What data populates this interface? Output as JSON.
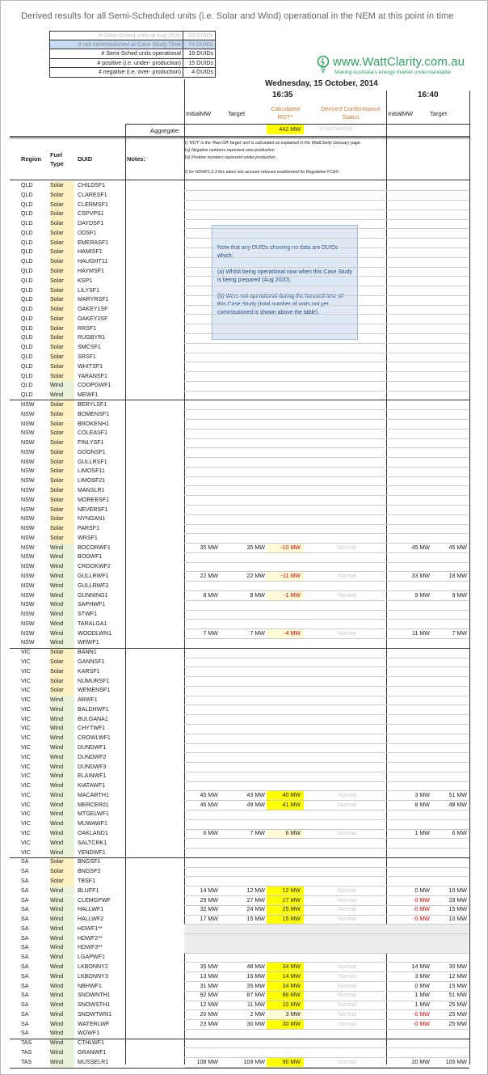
{
  "title": "Derived results for all Semi-Scheduled units (i.e. Solar and Wind) operational in the NEM at this point in time",
  "summary": [
    {
      "label": "# Semi-Sched units at Aug 2020",
      "value": "93 DUIDs",
      "style": "dim"
    },
    {
      "label": "# not commissioned at Case Study Time",
      "value": "74 DUIDs",
      "style": "hl"
    },
    {
      "label": "# Semi-Sched units operational",
      "value": "19 DUIDs",
      "style": ""
    },
    {
      "label": "# positive (i.e. under- production)",
      "value": "15 DUIDs",
      "style": ""
    },
    {
      "label": "# negative (i.e. over- production)",
      "value": "4 DUIDs",
      "style": ""
    }
  ],
  "logo": {
    "text": "www.WattClarity.com.au",
    "tagline": "Making Australia's energy market understandable"
  },
  "date": "Wednesday, 15 October, 2014",
  "time1": "16:35",
  "time2": "16:40",
  "headers": {
    "initial": "InitialMW",
    "target": "Target",
    "rot": "Calculated ROT*",
    "status": "Derived Conformance Status",
    "initial2": "InitialMW",
    "target2": "Target",
    "region": "Region",
    "fuel": "Fuel Type",
    "duid": "DUID",
    "notes": "Notes:"
  },
  "aggregate": {
    "label": "Aggregate:",
    "rot": "442 MW",
    "status": "0 not Normal"
  },
  "notes": [
    "1) 'ROT' is the 'Raw Off-Target' and is calculated as explained in the WattClarity Glossary page.",
    "1a) Negative numbers represent over-production",
    "1b) Positive numbers represent under-production .",
    "2) for HDWF1,2,3 this takes into account relevant enablement for Regulation FCAS"
  ],
  "callout": [
    "Note that any DUIDs showing no data are DUIDs which:",
    "(a) Whilst being operational now when this Case Study is being prepared (Aug 2020);",
    "(b) Were not operational during the focused time of this Case Study (total number of units not yet commissioned is shown above the table)."
  ],
  "rows": [
    [
      "QLD",
      "Solar",
      "CHILDSF1",
      "",
      "",
      "",
      "",
      "",
      ""
    ],
    [
      "QLD",
      "Solar",
      "CLARESF1",
      "",
      "",
      "",
      "",
      "",
      ""
    ],
    [
      "QLD",
      "Solar",
      "CLERMSF1",
      "",
      "",
      "",
      "",
      "",
      ""
    ],
    [
      "QLD",
      "Solar",
      "CSPVPS1",
      "",
      "",
      "",
      "",
      "",
      ""
    ],
    [
      "QLD",
      "Solar",
      "DAYDSF1",
      "",
      "",
      "",
      "",
      "",
      ""
    ],
    [
      "QLD",
      "Solar",
      "DDSF1",
      "",
      "",
      "",
      "",
      "",
      ""
    ],
    [
      "QLD",
      "Solar",
      "EMERASF1",
      "",
      "",
      "",
      "",
      "",
      ""
    ],
    [
      "QLD",
      "Solar",
      "HAMISF1",
      "",
      "",
      "",
      "",
      "",
      ""
    ],
    [
      "QLD",
      "Solar",
      "HAUGHT11",
      "",
      "",
      "",
      "",
      "",
      ""
    ],
    [
      "QLD",
      "Solar",
      "HAYMSF1",
      "",
      "",
      "",
      "",
      "",
      ""
    ],
    [
      "QLD",
      "Solar",
      "KSP1",
      "",
      "",
      "",
      "",
      "",
      ""
    ],
    [
      "QLD",
      "Solar",
      "LILYSF1",
      "",
      "",
      "",
      "",
      "",
      ""
    ],
    [
      "QLD",
      "Solar",
      "MARYRSF1",
      "",
      "",
      "",
      "",
      "",
      ""
    ],
    [
      "QLD",
      "Solar",
      "OAKEY1SF",
      "",
      "",
      "",
      "",
      "",
      ""
    ],
    [
      "QLD",
      "Solar",
      "OAKEY2SF",
      "",
      "",
      "",
      "",
      "",
      ""
    ],
    [
      "QLD",
      "Solar",
      "RRSF1",
      "",
      "",
      "",
      "",
      "",
      ""
    ],
    [
      "QLD",
      "Solar",
      "RUGBYR1",
      "",
      "",
      "",
      "",
      "",
      ""
    ],
    [
      "QLD",
      "Solar",
      "SMCSF1",
      "",
      "",
      "",
      "",
      "",
      ""
    ],
    [
      "QLD",
      "Solar",
      "SRSF1",
      "",
      "",
      "",
      "",
      "",
      ""
    ],
    [
      "QLD",
      "Solar",
      "WHITSF1",
      "",
      "",
      "",
      "",
      "",
      ""
    ],
    [
      "QLD",
      "Solar",
      "YARANSF1",
      "",
      "",
      "",
      "",
      "",
      ""
    ],
    [
      "QLD",
      "Wind",
      "COOPGWF1",
      "",
      "",
      "",
      "",
      "",
      ""
    ],
    [
      "QLD",
      "Wind",
      "MEWF1",
      "",
      "",
      "",
      "",
      "",
      ""
    ],
    [
      "NSW",
      "Solar",
      "BERYLSF1",
      "",
      "",
      "",
      "",
      "",
      ""
    ],
    [
      "NSW",
      "Solar",
      "BOMENSF1",
      "",
      "",
      "",
      "",
      "",
      ""
    ],
    [
      "NSW",
      "Solar",
      "BROKENH1",
      "",
      "",
      "",
      "",
      "",
      ""
    ],
    [
      "NSW",
      "Solar",
      "COLEASF1",
      "",
      "",
      "",
      "",
      "",
      ""
    ],
    [
      "NSW",
      "Solar",
      "FINLYSF1",
      "",
      "",
      "",
      "",
      "",
      ""
    ],
    [
      "NSW",
      "Solar",
      "GOONSF1",
      "",
      "",
      "",
      "",
      "",
      ""
    ],
    [
      "NSW",
      "Solar",
      "GULLRSF1",
      "",
      "",
      "",
      "",
      "",
      ""
    ],
    [
      "NSW",
      "Solar",
      "LIMOSF11",
      "",
      "",
      "",
      "",
      "",
      ""
    ],
    [
      "NSW",
      "Solar",
      "LIMOSF21",
      "",
      "",
      "",
      "",
      "",
      ""
    ],
    [
      "NSW",
      "Solar",
      "MANSLR1",
      "",
      "",
      "",
      "",
      "",
      ""
    ],
    [
      "NSW",
      "Solar",
      "MOREESF1",
      "",
      "",
      "",
      "",
      "",
      ""
    ],
    [
      "NSW",
      "Solar",
      "NEVERSF1",
      "",
      "",
      "",
      "",
      "",
      ""
    ],
    [
      "NSW",
      "Solar",
      "NYNGAN1",
      "",
      "",
      "",
      "",
      "",
      ""
    ],
    [
      "NSW",
      "Solar",
      "PARSF1",
      "",
      "",
      "",
      "",
      "",
      ""
    ],
    [
      "NSW",
      "Solar",
      "WRSF1",
      "",
      "",
      "",
      "",
      "",
      ""
    ],
    [
      "NSW",
      "Wind",
      "BOCORWF1",
      "35 MW",
      "35 MW",
      "-10 MW",
      "Normal",
      "45 MW",
      "45 MW"
    ],
    [
      "NSW",
      "Wind",
      "BODWF1",
      "",
      "",
      "",
      "",
      "",
      ""
    ],
    [
      "NSW",
      "Wind",
      "CROOKWF2",
      "",
      "",
      "",
      "",
      "",
      ""
    ],
    [
      "NSW",
      "Wind",
      "GULLRWF1",
      "22 MW",
      "22 MW",
      "-11 MW",
      "Normal",
      "33 MW",
      "18 MW"
    ],
    [
      "NSW",
      "Wind",
      "GULLRWF2",
      "",
      "",
      "",
      "",
      "",
      ""
    ],
    [
      "NSW",
      "Wind",
      "GUNNING1",
      "8 MW",
      "8 MW",
      "-1 MW",
      "Normal",
      "9 MW",
      "9 MW"
    ],
    [
      "NSW",
      "Wind",
      "SAPHWF1",
      "",
      "",
      "",
      "",
      "",
      ""
    ],
    [
      "NSW",
      "Wind",
      "STWF1",
      "",
      "",
      "",
      "",
      "",
      ""
    ],
    [
      "NSW",
      "Wind",
      "TARALGA1",
      "",
      "",
      "",
      "",
      "",
      ""
    ],
    [
      "NSW",
      "Wind",
      "WOODLWN1",
      "7 MW",
      "7 MW",
      "-4 MW",
      "Normal",
      "11 MW",
      "7 MW"
    ],
    [
      "NSW",
      "Wind",
      "WRWF1",
      "",
      "",
      "",
      "",
      "",
      ""
    ],
    [
      "VIC",
      "Solar",
      "BANN1",
      "",
      "",
      "",
      "",
      "",
      ""
    ],
    [
      "VIC",
      "Solar",
      "GANNSF1",
      "",
      "",
      "",
      "",
      "",
      ""
    ],
    [
      "VIC",
      "Solar",
      "KARSF1",
      "",
      "",
      "",
      "",
      "",
      ""
    ],
    [
      "VIC",
      "Solar",
      "NUMURSF1",
      "",
      "",
      "",
      "",
      "",
      ""
    ],
    [
      "VIC",
      "Solar",
      "WEMENSF1",
      "",
      "",
      "",
      "",
      "",
      ""
    ],
    [
      "VIC",
      "Wind",
      "ARWF1",
      "",
      "",
      "",
      "",
      "",
      ""
    ],
    [
      "VIC",
      "Wind",
      "BALDHWF1",
      "",
      "",
      "",
      "",
      "",
      ""
    ],
    [
      "VIC",
      "Wind",
      "BULGANA1",
      "",
      "",
      "",
      "",
      "",
      ""
    ],
    [
      "VIC",
      "Wind",
      "CHYTWF1",
      "",
      "",
      "",
      "",
      "",
      ""
    ],
    [
      "VIC",
      "Wind",
      "CROWLWF1",
      "",
      "",
      "",
      "",
      "",
      ""
    ],
    [
      "VIC",
      "Wind",
      "DUNDWF1",
      "",
      "",
      "",
      "",
      "",
      ""
    ],
    [
      "VIC",
      "Wind",
      "DUNDWF2",
      "",
      "",
      "",
      "",
      "",
      ""
    ],
    [
      "VIC",
      "Wind",
      "DUNDWF3",
      "",
      "",
      "",
      "",
      "",
      ""
    ],
    [
      "VIC",
      "Wind",
      "ELAINWF1",
      "",
      "",
      "",
      "",
      "",
      ""
    ],
    [
      "VIC",
      "Wind",
      "KIATAWF1",
      "",
      "",
      "",
      "",
      "",
      ""
    ],
    [
      "VIC",
      "Wind",
      "MACARTH1",
      "45 MW",
      "43 MW",
      "40 MW",
      "Normal",
      "3 MW",
      "51 MW"
    ],
    [
      "VIC",
      "Wind",
      "MERCER01",
      "46 MW",
      "49 MW",
      "41 MW",
      "Normal",
      "8 MW",
      "48 MW"
    ],
    [
      "VIC",
      "Wind",
      "MTGELWF1",
      "",
      "",
      "",
      "",
      "",
      ""
    ],
    [
      "VIC",
      "Wind",
      "MUWAWF1",
      "",
      "",
      "",
      "",
      "",
      ""
    ],
    [
      "VIC",
      "Wind",
      "OAKLAND1",
      "6 MW",
      "7 MW",
      "6 MW",
      "Normal",
      "1 MW",
      "6 MW"
    ],
    [
      "VIC",
      "Wind",
      "SALTCRK1",
      "",
      "",
      "",
      "",
      "",
      ""
    ],
    [
      "VIC",
      "Wind",
      "YENDWF1",
      "",
      "",
      "",
      "",
      "",
      ""
    ],
    [
      "SA",
      "Solar",
      "BNGSF1",
      "",
      "",
      "",
      "",
      "",
      ""
    ],
    [
      "SA",
      "Solar",
      "BNGSF2",
      "",
      "",
      "",
      "",
      "",
      ""
    ],
    [
      "SA",
      "Solar",
      "TBSF1",
      "",
      "",
      "",
      "",
      "",
      ""
    ],
    [
      "SA",
      "Wind",
      "BLUFF1",
      "14 MW",
      "12 MW",
      "12 MW",
      "Normal",
      "0 MW",
      "10 MW"
    ],
    [
      "SA",
      "Wind",
      "CLEMGPWF",
      "29 MW",
      "27 MW",
      "27 MW",
      "Normal",
      "-0 MW",
      "29 MW"
    ],
    [
      "SA",
      "Wind",
      "HALLWF1",
      "32 MW",
      "24 MW",
      "25 MW",
      "Normal",
      "-0 MW",
      "15 MW"
    ],
    [
      "SA",
      "Wind",
      "HALLWF2",
      "17 MW",
      "15 MW",
      "15 MW",
      "Normal",
      "-0 MW",
      "10 MW"
    ],
    [
      "SA",
      "Wind",
      "HDWF1**",
      "",
      "",
      "",
      "",
      "",
      ""
    ],
    [
      "SA",
      "Wind",
      "HDWF2**",
      "",
      "",
      "",
      "",
      "",
      ""
    ],
    [
      "SA",
      "Wind",
      "HDWF3**",
      "",
      "",
      "",
      "",
      "",
      ""
    ],
    [
      "SA",
      "Wind",
      "LGAPWF1",
      "",
      "",
      "",
      "",
      "",
      ""
    ],
    [
      "SA",
      "Wind",
      "LKBONNY2",
      "35 MW",
      "48 MW",
      "34 MW",
      "Normal",
      "14 MW",
      "30 MW"
    ],
    [
      "SA",
      "Wind",
      "LKBONNY3",
      "13 MW",
      "16 MW",
      "14 MW",
      "Normal",
      "3 MW",
      "12 MW"
    ],
    [
      "SA",
      "Wind",
      "NBHWF1",
      "31 MW",
      "35 MW",
      "34 MW",
      "Normal",
      "0 MW",
      "15 MW"
    ],
    [
      "SA",
      "Wind",
      "SNOWNTH1",
      "92 MW",
      "87 MW",
      "86 MW",
      "Normal",
      "1 MW",
      "51 MW"
    ],
    [
      "SA",
      "Wind",
      "SNOWSTH1",
      "12 MW",
      "11 MW",
      "10 MW",
      "Normal",
      "1 MW",
      "25 MW"
    ],
    [
      "SA",
      "Wind",
      "SNOWTWN1",
      "20 MW",
      "2 MW",
      "3 MW",
      "Normal",
      "-0 MW",
      "25 MW"
    ],
    [
      "SA",
      "Wind",
      "WATERLWF",
      "23 MW",
      "30 MW",
      "30 MW",
      "Normal",
      "-0 MW",
      "25 MW"
    ],
    [
      "SA",
      "Wind",
      "WGWF1",
      "",
      "",
      "",
      "",
      "",
      ""
    ],
    [
      "TAS",
      "Wind",
      "CTHLWF1",
      "",
      "",
      "",
      "",
      "",
      ""
    ],
    [
      "TAS",
      "Wind",
      "GRANWF1",
      "",
      "",
      "",
      "",
      "",
      ""
    ],
    [
      "TAS",
      "Wind",
      "MUSSELR1",
      "108 MW",
      "109 MW",
      "90 MW",
      "Normal",
      "20 MW",
      "105 MW"
    ]
  ]
}
